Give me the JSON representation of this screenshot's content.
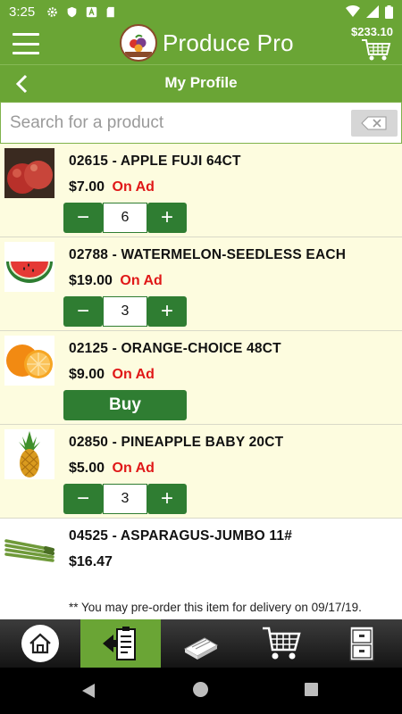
{
  "status": {
    "time": "3:25"
  },
  "header": {
    "app_title": "Produce Pro",
    "cart_total": "$233.10",
    "logo_text": "PRODUCE PRO SOFTWARE"
  },
  "subheader": {
    "title": "My Profile"
  },
  "search": {
    "placeholder": "Search for a product"
  },
  "products": [
    {
      "name": "02615 - APPLE FUJI 64CT",
      "price": "$7.00",
      "badge": "On Ad",
      "quantity": "6",
      "image_icon": "apple-icon"
    },
    {
      "name": "02788 - WATERMELON-SEEDLESS EACH",
      "price": "$19.00",
      "badge": "On Ad",
      "quantity": "3",
      "image_icon": "watermelon-icon"
    },
    {
      "name": "02125 - ORANGE-CHOICE 48CT",
      "price": "$9.00",
      "badge": "On Ad",
      "button_label": "Buy",
      "image_icon": "orange-icon"
    },
    {
      "name": "02850 - PINEAPPLE BABY 20CT",
      "price": "$5.00",
      "badge": "On Ad",
      "quantity": "3",
      "image_icon": "pineapple-icon"
    },
    {
      "name": "04525 - ASPARAGUS-JUMBO 11#",
      "price": "$16.47",
      "note": "** You may pre-order this item for delivery on 09/17/19.",
      "image_icon": "asparagus-icon"
    }
  ],
  "qty_controls": {
    "minus": "−",
    "plus": "+"
  },
  "tabbar": {
    "items": [
      "home-icon",
      "order-entry-icon",
      "catalog-icon",
      "cart-icon",
      "file-cabinet-icon"
    ],
    "active_index": 1
  },
  "colors": {
    "brand_green": "#6aa535",
    "button_green": "#2f7d32",
    "ad_red": "#e01818",
    "row_background": "#fdfcdf"
  }
}
